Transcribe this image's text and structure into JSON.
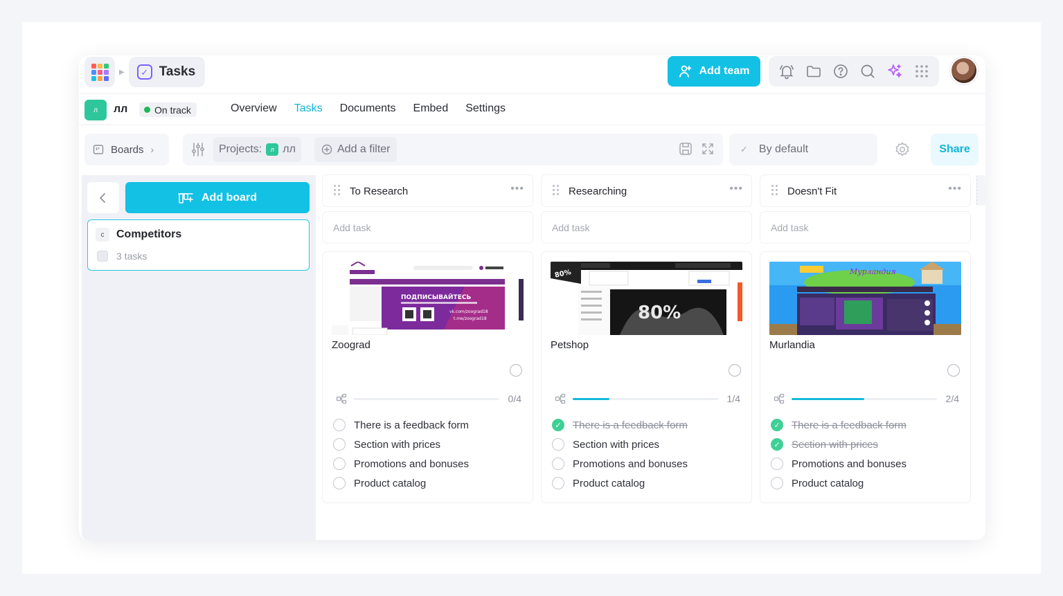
{
  "header": {
    "app_title": "Tasks",
    "add_team_label": "Add team",
    "apps_colors": [
      "#ff5c5c",
      "#ffb84d",
      "#33c97a",
      "#4d8dff",
      "#ff5c8a",
      "#a77bff",
      "#1cc1e6",
      "#ff9f43",
      "#5b6ef5"
    ]
  },
  "project": {
    "badge": "л",
    "name": "лл",
    "status": "On track",
    "tabs": [
      {
        "label": "Overview"
      },
      {
        "label": "Tasks"
      },
      {
        "label": "Documents"
      },
      {
        "label": "Embed"
      },
      {
        "label": "Settings"
      }
    ],
    "active_tab": "Tasks"
  },
  "filters": {
    "boards_label": "Boards",
    "projects_label": "Projects:",
    "project_badge": "л",
    "project_name": "лл",
    "add_filter_label": "Add a filter",
    "sort_label": "By default",
    "share_label": "Share"
  },
  "sidebar": {
    "add_board_label": "Add board",
    "boards": [
      {
        "letter": "c",
        "name": "Competitors",
        "count": "3 tasks"
      }
    ]
  },
  "columns": [
    {
      "title": "To Research",
      "add_task": "Add task",
      "card": {
        "name": "Zoograd",
        "progress": "0/4",
        "progress_fraction": 0,
        "checklist": [
          {
            "text": "There is a feedback form",
            "done": false
          },
          {
            "text": "Section with prices",
            "done": false
          },
          {
            "text": "Promotions and bonuses",
            "done": false
          },
          {
            "text": "Product catalog",
            "done": false
          }
        ]
      }
    },
    {
      "title": "Researching",
      "add_task": "Add task",
      "card": {
        "name": "Petshop",
        "progress": "1/4",
        "progress_fraction": 0.25,
        "checklist": [
          {
            "text": "There is a feedback form",
            "done": true
          },
          {
            "text": "Section with prices",
            "done": false
          },
          {
            "text": "Promotions and bonuses",
            "done": false
          },
          {
            "text": "Product catalog",
            "done": false
          }
        ]
      }
    },
    {
      "title": "Doesn't Fit",
      "add_task": "Add task",
      "card": {
        "name": "Murlandia",
        "progress": "2/4",
        "progress_fraction": 0.5,
        "checklist": [
          {
            "text": "There is a feedback form",
            "done": true
          },
          {
            "text": "Section with prices",
            "done": true
          },
          {
            "text": "Promotions and bonuses",
            "done": false
          },
          {
            "text": "Product catalog",
            "done": false
          }
        ]
      }
    }
  ]
}
